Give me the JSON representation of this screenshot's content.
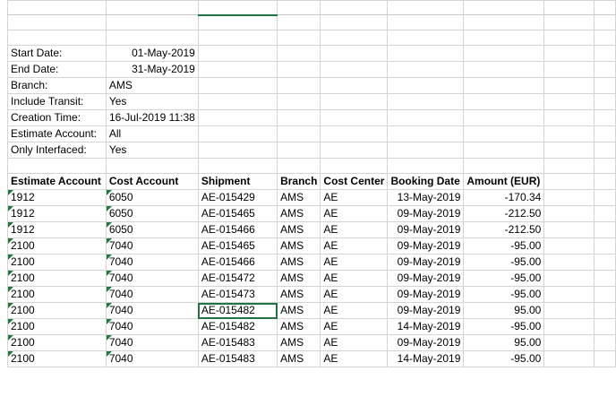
{
  "params": [
    {
      "label": "Start Date:",
      "value": "01-May-2019",
      "align": "r"
    },
    {
      "label": "End Date:",
      "value": "31-May-2019",
      "align": "r"
    },
    {
      "label": "Branch:",
      "value": "AMS",
      "align": "l"
    },
    {
      "label": "Include Transit:",
      "value": "Yes",
      "align": "l"
    },
    {
      "label": "Creation Time:",
      "value": "16-Jul-2019 11:38",
      "align": "r"
    },
    {
      "label": "Estimate Account:",
      "value": "All",
      "align": "l"
    },
    {
      "label": "Only Interfaced:",
      "value": "Yes",
      "align": "l"
    }
  ],
  "table": {
    "headers": [
      "Estimate Account",
      "Cost Account",
      "Shipment",
      "Branch",
      "Cost Center",
      "Booking Date",
      "Amount (EUR)"
    ],
    "rows": [
      [
        "1912",
        "6050",
        "AE-015429",
        "AMS",
        "AE",
        "13-May-2019",
        "-170.34"
      ],
      [
        "1912",
        "6050",
        "AE-015465",
        "AMS",
        "AE",
        "09-May-2019",
        "-212.50"
      ],
      [
        "1912",
        "6050",
        "AE-015466",
        "AMS",
        "AE",
        "09-May-2019",
        "-212.50"
      ],
      [
        "2100",
        "7040",
        "AE-015465",
        "AMS",
        "AE",
        "09-May-2019",
        "-95.00"
      ],
      [
        "2100",
        "7040",
        "AE-015466",
        "AMS",
        "AE",
        "09-May-2019",
        "-95.00"
      ],
      [
        "2100",
        "7040",
        "AE-015472",
        "AMS",
        "AE",
        "09-May-2019",
        "-95.00"
      ],
      [
        "2100",
        "7040",
        "AE-015473",
        "AMS",
        "AE",
        "09-May-2019",
        "-95.00"
      ],
      [
        "2100",
        "7040",
        "AE-015482",
        "AMS",
        "AE",
        "09-May-2019",
        "95.00"
      ],
      [
        "2100",
        "7040",
        "AE-015482",
        "AMS",
        "AE",
        "14-May-2019",
        "-95.00"
      ],
      [
        "2100",
        "7040",
        "AE-015483",
        "AMS",
        "AE",
        "09-May-2019",
        "95.00"
      ],
      [
        "2100",
        "7040",
        "AE-015483",
        "AMS",
        "AE",
        "14-May-2019",
        "-95.00"
      ]
    ]
  },
  "active_cell": {
    "row": 7,
    "col": 2
  },
  "colors": {
    "gridline": "#d4d4d4",
    "selection": "#217346",
    "error_triangle": "#1f7a3a"
  }
}
